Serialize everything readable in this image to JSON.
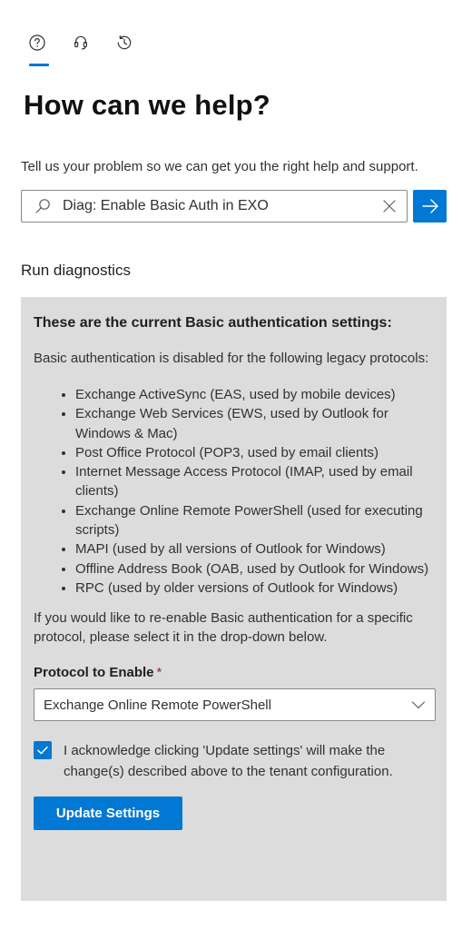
{
  "tabs": [
    {
      "icon": "help-icon",
      "active": true
    },
    {
      "icon": "headset-icon",
      "active": false
    },
    {
      "icon": "history-icon",
      "active": false
    }
  ],
  "header": {
    "title": "How can we help?",
    "subtitle": "Tell us your problem so we can get you the right help and support."
  },
  "search": {
    "value": "Diag: Enable Basic Auth in EXO"
  },
  "diagnostics": {
    "section_title": "Run diagnostics",
    "heading": "These are the current Basic authentication settings:",
    "intro": "Basic authentication is disabled for the following legacy protocols:",
    "protocols": [
      "Exchange ActiveSync (EAS, used by mobile devices)",
      "Exchange Web Services (EWS, used by Outlook for Windows & Mac)",
      "Post Office Protocol (POP3, used by email clients)",
      "Internet Message Access Protocol (IMAP, used by email clients)",
      "Exchange Online Remote PowerShell (used for executing scripts)",
      "MAPI (used by all versions of Outlook for Windows)",
      "Offline Address Book (OAB, used by Outlook for Windows)",
      "RPC (used by older versions of Outlook for Windows)"
    ],
    "reenable_text": "If you would like to re-enable Basic authentication for a specific protocol, please select it in the drop-down below.",
    "field_label": "Protocol to Enable",
    "required_marker": "*",
    "selected_protocol": "Exchange Online Remote PowerShell",
    "acknowledge_checked": true,
    "acknowledge_text": "I acknowledge clicking 'Update settings' will make the change(s) described above to the tenant configuration.",
    "update_button_label": "Update Settings"
  },
  "colors": {
    "accent": "#0078d4",
    "panel_background": "#dcdcdc",
    "required": "#a4262c"
  }
}
